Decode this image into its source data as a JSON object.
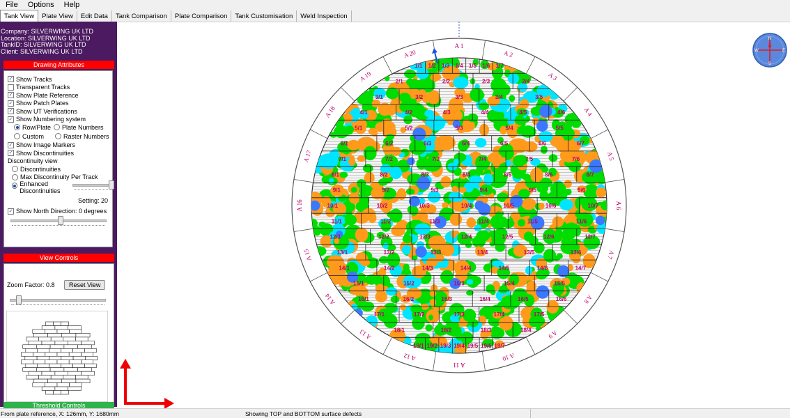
{
  "menu": {
    "file": "File",
    "options": "Options",
    "help": "Help"
  },
  "tabs": [
    "Tank View",
    "Plate View",
    "Edit Data",
    "Tank Comparison",
    "Plate Comparison",
    "Tank Customisation",
    "Weld Inspection"
  ],
  "info": {
    "company": "Company: SILVERWING UK LTD",
    "location": "Location: SILVERWING UK LTD",
    "tank": "TankID: SILVERWING UK LTD",
    "client": "Client: SILVERWING UK LTD"
  },
  "drawing": {
    "header": "Drawing Attributes",
    "show_tracks": "Show Tracks",
    "transparent_tracks": "Transparent Tracks",
    "show_plate_reference": "Show Plate Reference",
    "show_patch_plates": "Show Patch Plates",
    "show_ut": "Show UT Verifications",
    "show_numbering": "Show Numbering system",
    "row_plate": "Row/Plate",
    "plate_numbers": "Plate Numbers",
    "custom": "Custom",
    "raster_numbers": "Raster Numbers",
    "show_image_markers": "Show Image Markers",
    "show_discontinuities": "Show Discontinuities",
    "disc_view": "Discontinuity view",
    "discontinuities": "Discontinuities",
    "max_disc": "Max Discontinuity Per Track",
    "enhanced": "Enhanced",
    "enhanced2": "Discontinuities",
    "setting": "Setting: 20",
    "show_north": "Show North Direction: 0 degrees"
  },
  "view_controls": {
    "header": "View Controls",
    "zoom": "Zoom Factor: 0.8",
    "reset": "Reset View"
  },
  "threshold": {
    "header": "Threshold Controls"
  },
  "status": {
    "left": "From plate reference, X: 126mm,  Y: 1680mm",
    "center": "Showing TOP and BOTTOM surface defects"
  },
  "compass": {
    "n": "N",
    "s": "S",
    "e": "E",
    "w": "W"
  },
  "tank": {
    "angle_labels": [
      "A 1",
      "A 2",
      "A 3",
      "A 4",
      "A 5",
      "A 6",
      "A 7",
      "A 8",
      "A 9",
      "A 10",
      "A 11",
      "A 12",
      "A 13",
      "A 14",
      "A 15",
      "A 16",
      "A 17",
      "A 18",
      "A 19",
      "A 20"
    ],
    "rows": [
      {
        "row": 1,
        "plates": [
          "1/1",
          "1/2",
          "1/3",
          "1/4",
          "1/5",
          "1/6",
          "1/7"
        ]
      },
      {
        "row": 2,
        "plates": [
          "2/1",
          "2/2",
          "2/3",
          "2/4"
        ]
      },
      {
        "row": 3,
        "plates": [
          "3/1",
          "3/2",
          "3/3",
          "3/4",
          "3/5"
        ]
      },
      {
        "row": 4,
        "plates": [
          "4/1",
          "4/2",
          "4/3",
          "4/4",
          "4/5",
          "4/6"
        ]
      },
      {
        "row": 5,
        "plates": [
          "5/1",
          "5/2",
          "5/3",
          "5/4",
          "5/5"
        ]
      },
      {
        "row": 6,
        "plates": [
          "6/1",
          "6/2",
          "6/3",
          "6/4",
          "6/5",
          "6/6",
          "6/7"
        ]
      },
      {
        "row": 7,
        "plates": [
          "7/1",
          "7/2",
          "7/3",
          "7/4",
          "7/5",
          "7/6"
        ]
      },
      {
        "row": 8,
        "plates": [
          "8/1",
          "8/2",
          "8/3",
          "8/4",
          "8/5",
          "8/6",
          "8/7"
        ]
      },
      {
        "row": 9,
        "plates": [
          "9/1",
          "9/2",
          "9/3",
          "9/4",
          "9/5",
          "9/6"
        ]
      },
      {
        "row": 10,
        "plates": [
          "10/1",
          "10/2",
          "10/3",
          "10/4",
          "10/5",
          "10/6",
          "10/7"
        ]
      },
      {
        "row": 11,
        "plates": [
          "11/1",
          "11/2",
          "11/3",
          "11/4",
          "11/5",
          "11/6"
        ]
      },
      {
        "row": 12,
        "plates": [
          "12/1",
          "12/2",
          "12/3",
          "12/4",
          "12/5",
          "12/6",
          "12/7"
        ]
      },
      {
        "row": 13,
        "plates": [
          "13/1",
          "13/2",
          "13/3",
          "13/4",
          "13/5",
          "13/6"
        ]
      },
      {
        "row": 14,
        "plates": [
          "14/1",
          "14/2",
          "14/3",
          "14/4",
          "14/5",
          "14/6",
          "14/7"
        ]
      },
      {
        "row": 15,
        "plates": [
          "15/1",
          "15/2",
          "15/3",
          "15/4",
          "15/5"
        ]
      },
      {
        "row": 16,
        "plates": [
          "16/1",
          "16/2",
          "16/3",
          "16/4",
          "16/5",
          "16/6"
        ]
      },
      {
        "row": 17,
        "plates": [
          "17/1",
          "17/2",
          "17/3",
          "17/4",
          "17/5"
        ]
      },
      {
        "row": 18,
        "plates": [
          "18/1",
          "18/2",
          "18/3",
          "18/4"
        ]
      },
      {
        "row": 19,
        "plates": [
          "19/1",
          "19/2",
          "19/3",
          "19/4",
          "19/5",
          "19/6",
          "19/7"
        ]
      }
    ],
    "colors": {
      "ring": "#555555",
      "green": "#00dd00",
      "orange": "#ff9a1a",
      "cyan": "#00e5ff",
      "blue": "#3a78ff",
      "label": "#c0006a",
      "north": "#1a4fdc"
    }
  }
}
